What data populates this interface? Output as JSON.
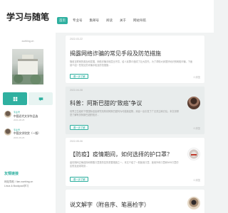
{
  "header": {
    "title": "学习与随笔",
    "nav": [
      {
        "label": "首页",
        "active": true
      },
      {
        "label": "专业号"
      },
      {
        "label": "集邮号"
      },
      {
        "label": "阅读"
      },
      {
        "label": "关于"
      },
      {
        "label": "网站导航"
      }
    ]
  },
  "sidebar": {
    "site_url": "xuebing.cn",
    "tabs": [
      {
        "icon": "grid-icon",
        "active": true
      },
      {
        "icon": "chat-icon",
        "active": false
      }
    ],
    "recent": [
      {
        "category": "专业号",
        "title": "中国近代文学作品选",
        "date": "2021-08-25"
      },
      {
        "category": "专业号",
        "title": "中国文学欣赏（一版）",
        "date": "2021-09-26"
      }
    ],
    "friends_heading": "友情链接",
    "friends": [
      "网站导航 / lian.xuebing.cn",
      "Linux & Bookpool学习"
    ]
  },
  "posts": [
    {
      "date": "2022-03-22",
      "title": "揭露网络诈骗的常见手段及防范措施",
      "excerpt": "随着互联网的普及和发展，网络诈骗手段层出不穷，给人民群众造成了巨大损失。为了帮助大家更好地识别网络诈骗，下面就介绍一些常见的诈骗手段及防范措施...",
      "read_label": "看一步了解",
      "views": "0 浏览",
      "gray": false
    },
    {
      "date": "2022-04-08",
      "title": "科普：阿斯巴甜的“致癌”争议",
      "excerpt": "世界卫生组织下属国际癌症研究机构将阿斯巴甜列为可能致癌物，消息一出引发了广泛关注和讨论。本文将带您了解有关阿斯巴甜的知识...",
      "read_label": "看一步了解",
      "views": "0 浏览",
      "gray": true
    },
    {
      "date": "2022-05-06",
      "title": "【防疫】疫情期间，如何选择的护口罩？",
      "excerpt": "疫情期间正确选择和佩戴口罩是防控的重要措施之一。本文介绍了一般医用口罩、医用外科口罩和N95口罩的区别及适用场景...",
      "read_label": "看一步了解",
      "views": "0 浏览",
      "gray": false
    },
    {
      "date": "",
      "title": "说文解字（附音序、笔画检字）",
      "excerpt": "",
      "read_label": "",
      "views": "",
      "gray": false
    }
  ]
}
